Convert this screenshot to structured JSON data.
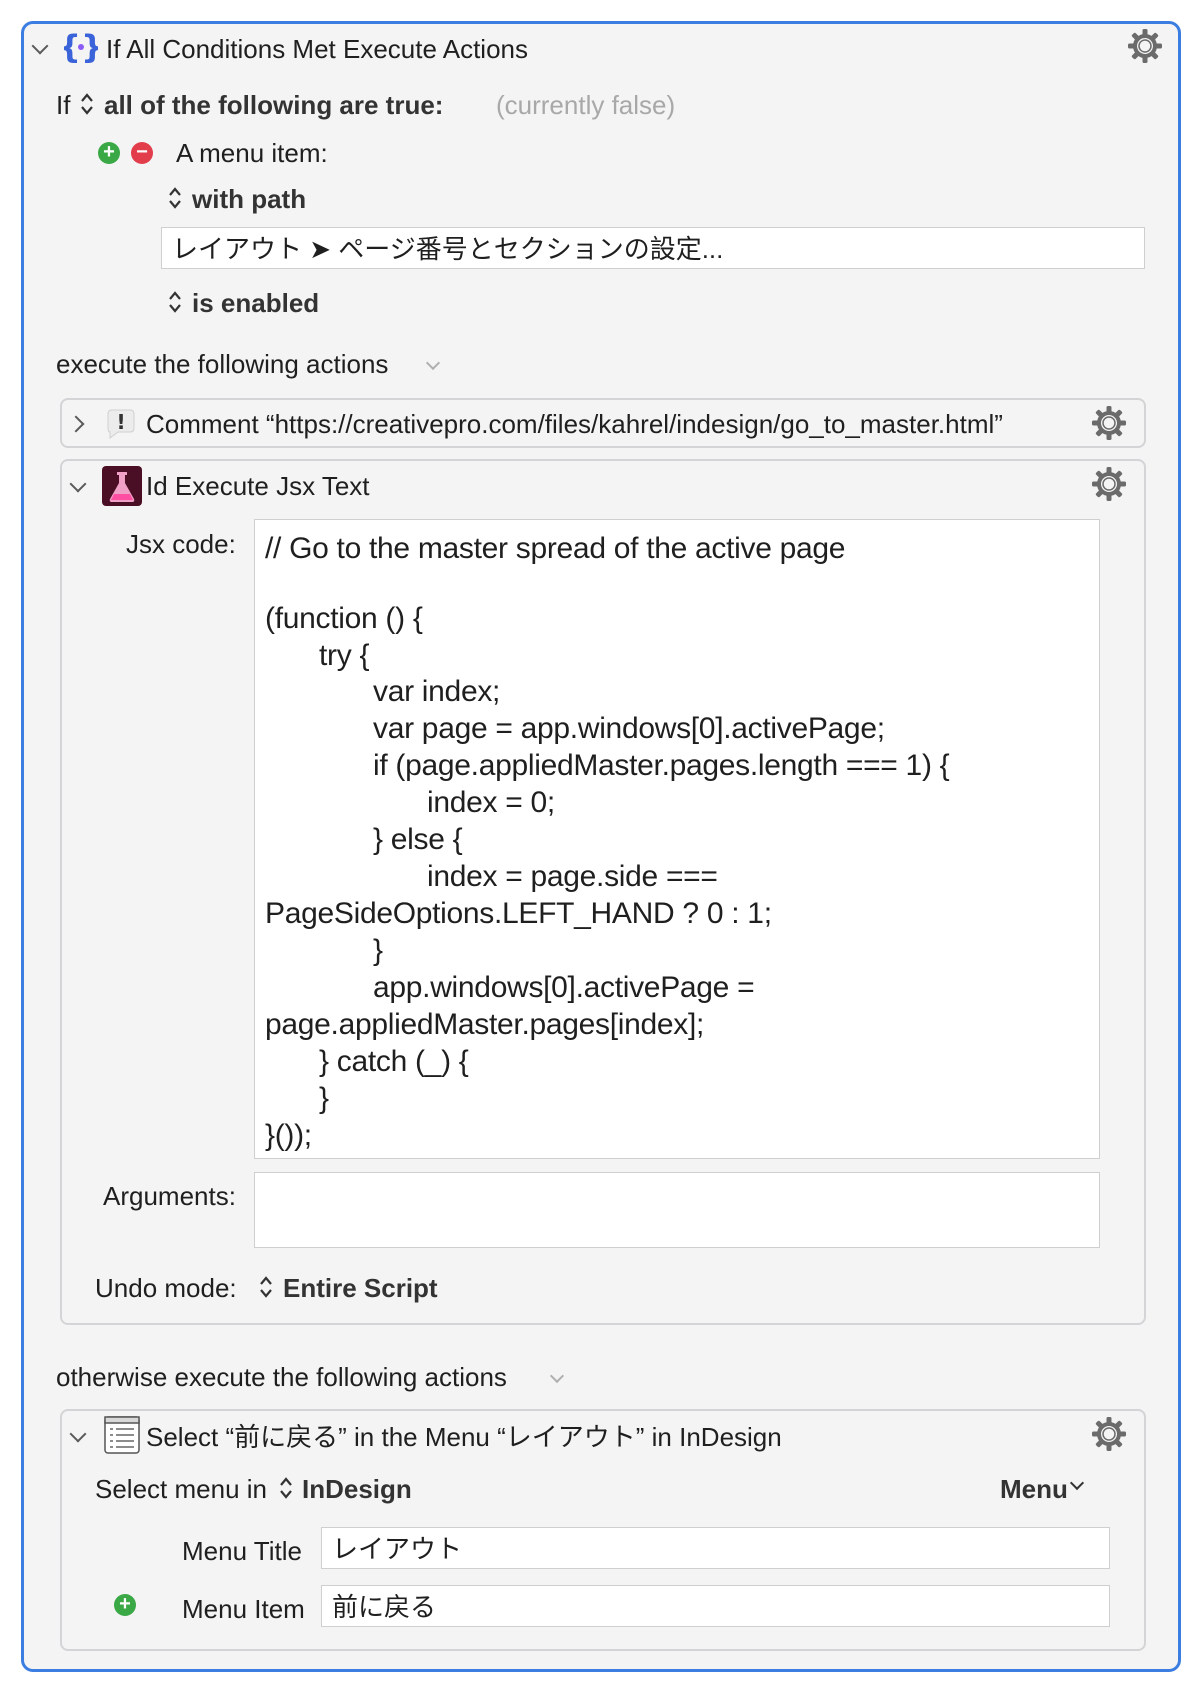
{
  "if_block": {
    "title": "If All Conditions Met Execute Actions",
    "if_label": "If",
    "condition_mode": "all of the following are true:",
    "status": "(currently false)",
    "condition": {
      "type_label": "A menu item:",
      "match_mode": "with path",
      "path_value": "レイアウト ➤ ページ番号とセクションの設定...",
      "state_mode": "is enabled"
    },
    "then_label": "execute the following actions",
    "else_label": "otherwise execute the following actions"
  },
  "comment_action": {
    "title": "Comment “https://creativepro.com/files/kahrel/indesign/go_to_master.html”"
  },
  "jsx_action": {
    "title": "Id Execute Jsx Text",
    "code_label": "Jsx code:",
    "code_lines": [
      "// Go to the master spread of the active page",
      "(function () {",
      "try {",
      "var index;",
      "var page = app.windows[0].activePage;",
      "if (page.appliedMaster.pages.length === 1) {",
      "index = 0;",
      "} else {",
      "index = page.side ===",
      "PageSideOptions.LEFT_HAND ? 0 : 1;",
      "}",
      "app.windows[0].activePage =",
      "page.appliedMaster.pages[index];",
      "} catch (_) {",
      "}",
      "}());"
    ],
    "arguments_label": "Arguments:",
    "arguments_value": "",
    "undo_label": "Undo mode:",
    "undo_value": "Entire Script"
  },
  "select_action": {
    "title": "Select “前に戻る” in the Menu “レイアウト” in InDesign",
    "select_in_label": "Select menu in",
    "app_value": "InDesign",
    "menu_button": "Menu",
    "menu_title_label": "Menu Title",
    "menu_title_value": "レイアウト",
    "menu_item_label": "Menu Item",
    "menu_item_value": "前に戻る"
  },
  "colors": {
    "accent": "#3b7de1",
    "add": "#3aa844",
    "remove": "#e23d4b",
    "background": "#f4f4f5"
  }
}
